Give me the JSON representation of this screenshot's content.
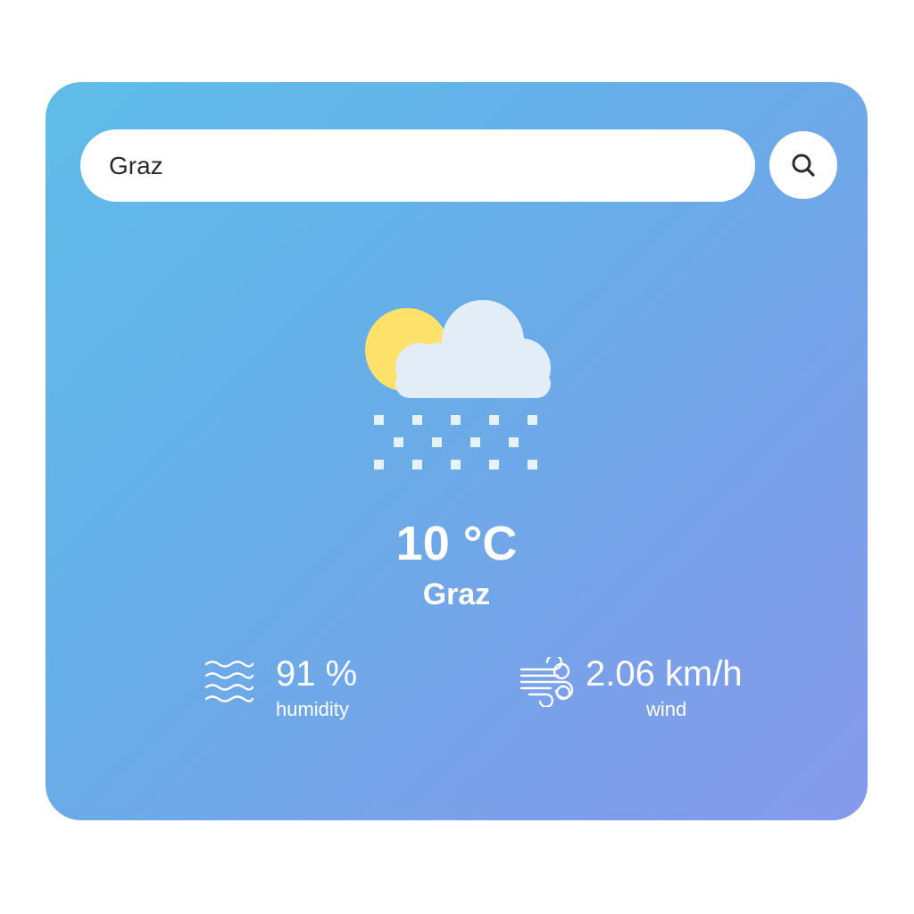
{
  "search": {
    "value": "Graz",
    "icon": "search-icon"
  },
  "weather": {
    "icon": "partly-cloudy-snow-icon",
    "temperature": "10 °C",
    "city": "Graz"
  },
  "humidity": {
    "icon": "humidity-waves-icon",
    "value": "91 %",
    "label": "humidity"
  },
  "wind": {
    "icon": "wind-icon",
    "value": "2.06 km/h",
    "label": "wind"
  },
  "colors": {
    "gradient_start": "#5fbde9",
    "gradient_end": "#869aec",
    "sun": "#fde16a",
    "cloud": "#e3edf8",
    "text": "#ffffff"
  }
}
